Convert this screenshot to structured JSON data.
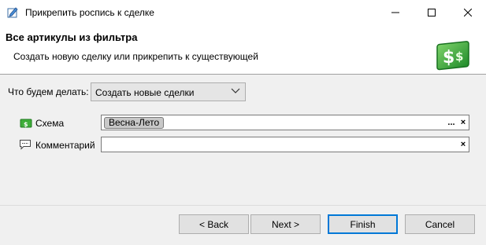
{
  "window": {
    "title": "Прикрепить роспись к сделке",
    "app_icon": "notebook-pen-icon",
    "min_icon": "minimize-icon",
    "max_icon": "maximize-icon",
    "close_icon": "close-icon"
  },
  "banner": {
    "title": "Все артикулы из фильтра",
    "subtitle": "Создать новую сделку или прикрепить к существующей",
    "logo_icon": "money-dollar-icon"
  },
  "form": {
    "action_label": "Что будем делать:",
    "action_value": "Создать новые сделки",
    "scheme_label": "Схема",
    "scheme_tag": "Весна-Лето",
    "scheme_browse": "...",
    "scheme_clear": "×",
    "comment_label": "Комментарий",
    "comment_value": "",
    "comment_clear": "×"
  },
  "buttons": {
    "back": "< Back",
    "next": "Next >",
    "finish": "Finish",
    "cancel": "Cancel"
  },
  "colors": {
    "accent": "#0078d7",
    "logo_green": "#2e9e3a"
  }
}
